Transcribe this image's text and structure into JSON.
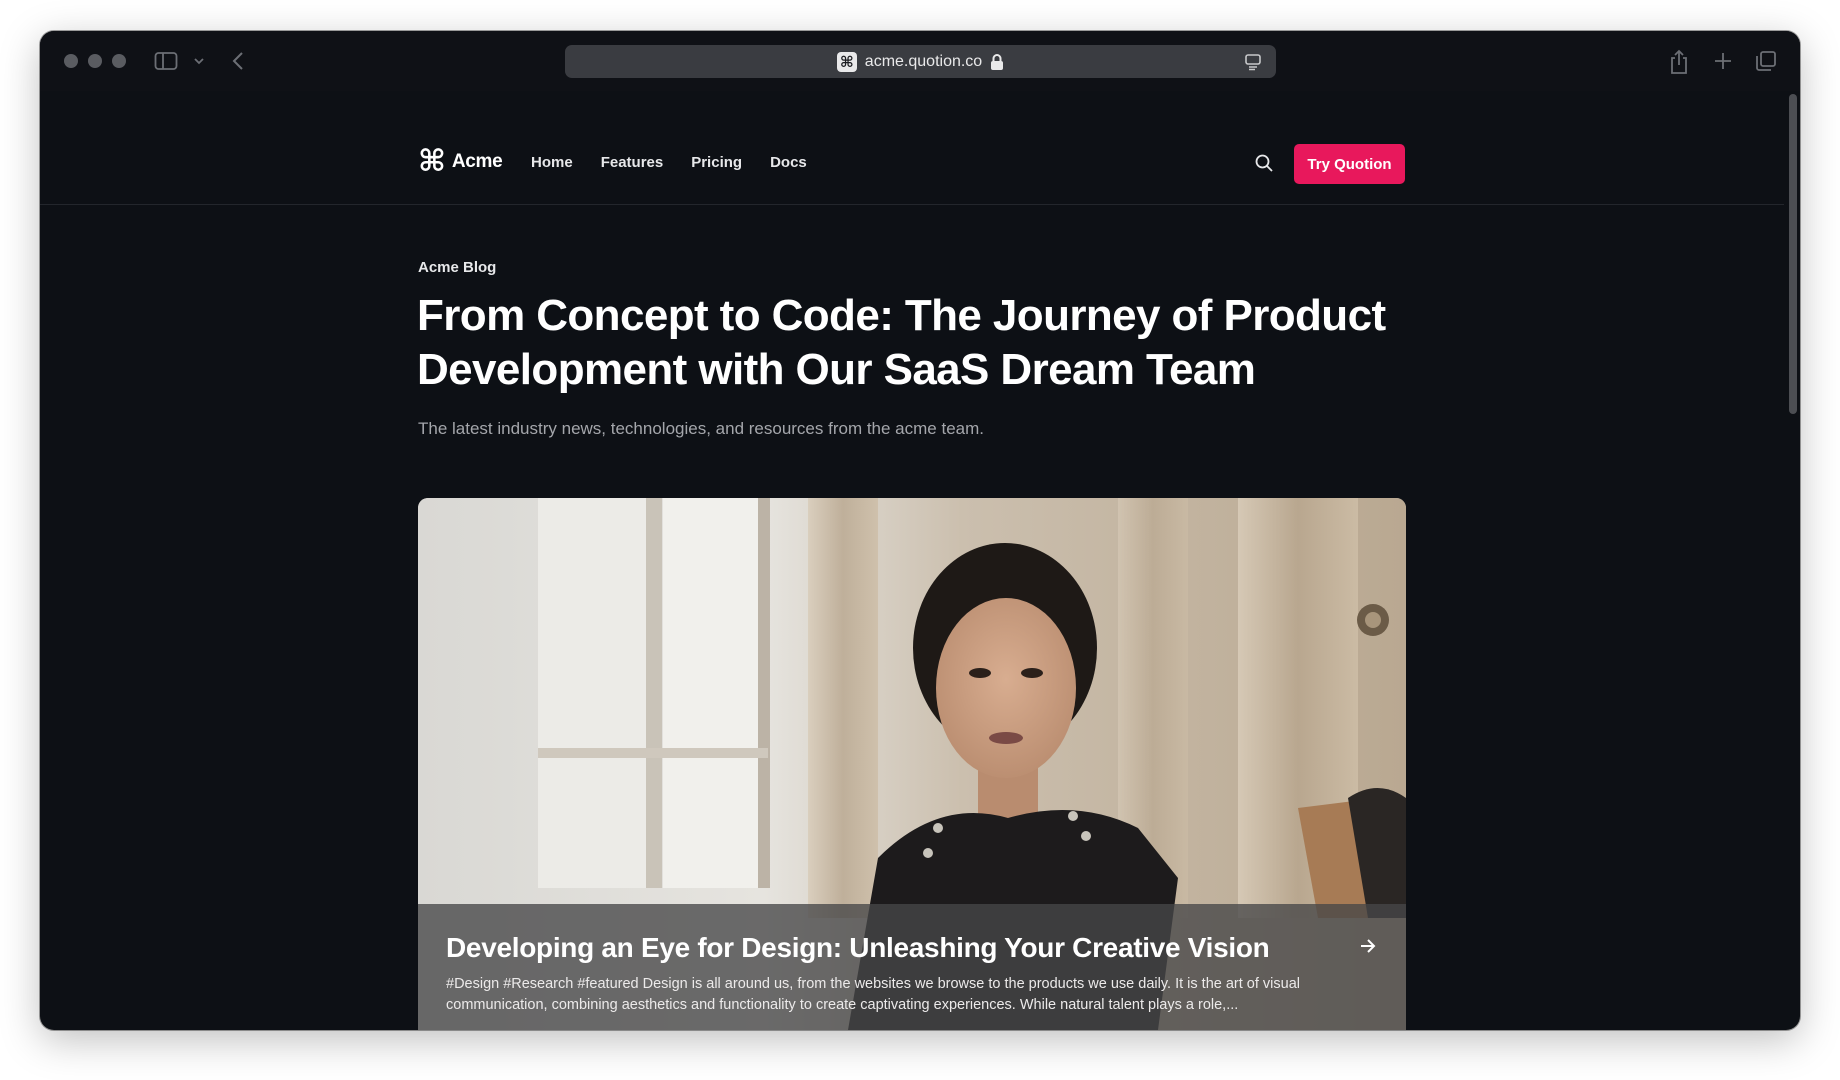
{
  "browser": {
    "url": "acme.quotion.co",
    "favicon": "command-icon"
  },
  "site": {
    "brand": "Acme",
    "nav": [
      {
        "label": "Home"
      },
      {
        "label": "Features"
      },
      {
        "label": "Pricing"
      },
      {
        "label": "Docs"
      }
    ],
    "cta_label": "Try Quotion",
    "accent_color": "#e8185c"
  },
  "hero": {
    "eyebrow": "Acme Blog",
    "title": "From Concept to Code: The Journey of Product Development with Our SaaS Dream Team",
    "subtitle": "The latest industry news, technologies, and resources from the acme team."
  },
  "featured_post": {
    "title": "Developing an Eye for Design: Unleashing Your Creative Vision",
    "tags": [
      "#Design",
      "#Research",
      "#featured"
    ],
    "excerpt": "Design is all around us, from the websites we browse to the products we use daily. It is the art of visual communication, combining aesthetics and functionality to create captivating experiences. While natural talent plays a role,..."
  }
}
